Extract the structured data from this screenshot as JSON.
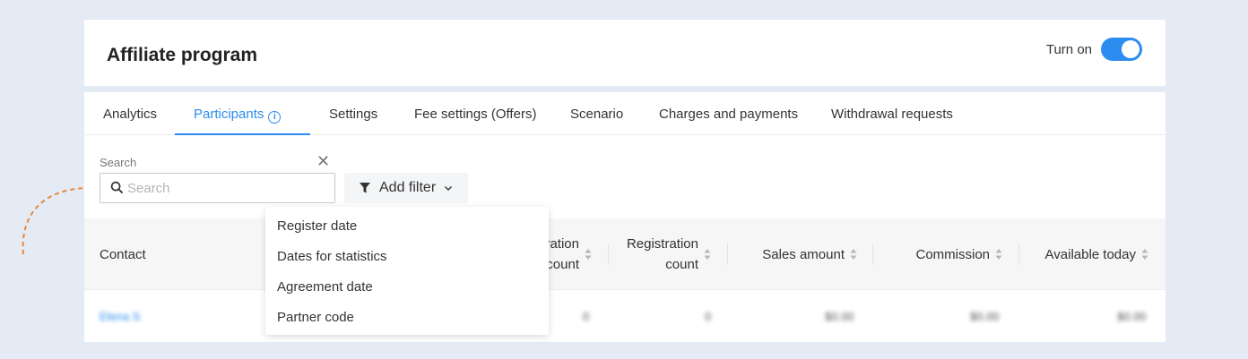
{
  "header": {
    "title": "Affiliate program",
    "toggle_label": "Turn on",
    "toggle_on": true
  },
  "tabs": [
    {
      "label": "Analytics",
      "active": false
    },
    {
      "label": "Participants",
      "active": true
    },
    {
      "label": "Settings",
      "active": false
    },
    {
      "label": "Fee settings (Offers)",
      "active": false
    },
    {
      "label": "Scenario",
      "active": false
    },
    {
      "label": "Charges and payments",
      "active": false
    },
    {
      "label": "Withdrawal requests",
      "active": false
    }
  ],
  "search": {
    "label": "Search",
    "placeholder": "Search",
    "value": ""
  },
  "filter": {
    "label": "Add filter",
    "options": [
      "Register date",
      "Dates for statistics",
      "Agreement date",
      "Partner code"
    ]
  },
  "table": {
    "columns": {
      "contact": "Contact",
      "partial_1": "ration",
      "partial_2": "count",
      "registration_1": "Registration",
      "registration_2": "count",
      "sales": "Sales amount",
      "commission": "Commission",
      "available": "Available today"
    },
    "row": {
      "contact": "Elena S",
      "visits": "0",
      "registrations": "0",
      "sales": "$0.00",
      "commission": "$0.00",
      "available": "$0.00"
    }
  },
  "colors": {
    "accent": "#2d8cf0",
    "background": "#e4ebf5",
    "arrow": "#e8893a"
  }
}
